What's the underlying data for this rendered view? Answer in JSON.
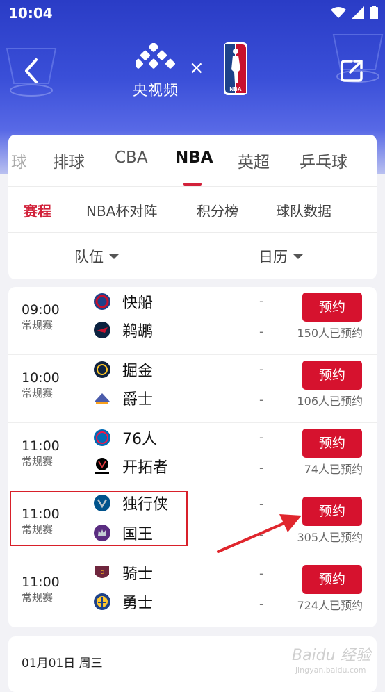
{
  "status": {
    "time": "10:04"
  },
  "header": {
    "brand_label": "央视频",
    "times_sign": "×",
    "nba_text": "NBA"
  },
  "sport_tabs": [
    {
      "label": "球",
      "active": false
    },
    {
      "label": "排球",
      "active": false
    },
    {
      "label": "CBA",
      "active": false
    },
    {
      "label": "NBA",
      "active": true
    },
    {
      "label": "英超",
      "active": false
    },
    {
      "label": "乒乓球",
      "active": false
    }
  ],
  "sub_tabs": [
    {
      "label": "赛程",
      "active": true
    },
    {
      "label": "NBA杯对阵",
      "active": false
    },
    {
      "label": "积分榜",
      "active": false
    },
    {
      "label": "球队数据",
      "active": false
    }
  ],
  "filters": {
    "team": "队伍",
    "calendar": "日历"
  },
  "games": [
    {
      "time": "09:00",
      "type": "常规赛",
      "home": "快船",
      "away": "鹈鹕",
      "home_score": "-",
      "away_score": "-",
      "button": "预约",
      "count": "150人已预约"
    },
    {
      "time": "10:00",
      "type": "常规赛",
      "home": "掘金",
      "away": "爵士",
      "home_score": "-",
      "away_score": "-",
      "button": "预约",
      "count": "106人已预约"
    },
    {
      "time": "11:00",
      "type": "常规赛",
      "home": "76人",
      "away": "开拓者",
      "home_score": "-",
      "away_score": "-",
      "button": "预约",
      "count": "74人已预约"
    },
    {
      "time": "11:00",
      "type": "常规赛",
      "home": "独行侠",
      "away": "国王",
      "home_score": "-",
      "away_score": "-",
      "button": "预约",
      "count": "305人已预约"
    },
    {
      "time": "11:00",
      "type": "常规赛",
      "home": "骑士",
      "away": "勇士",
      "home_score": "-",
      "away_score": "-",
      "button": "预约",
      "count": "724人已预约"
    }
  ],
  "date_header": "01月01日 周三",
  "watermark": "Baidu 经验",
  "watermark_sub": "jingyan.baidu.com",
  "colors": {
    "accent": "#d6122e",
    "header_blue": "#2a3cc6"
  }
}
